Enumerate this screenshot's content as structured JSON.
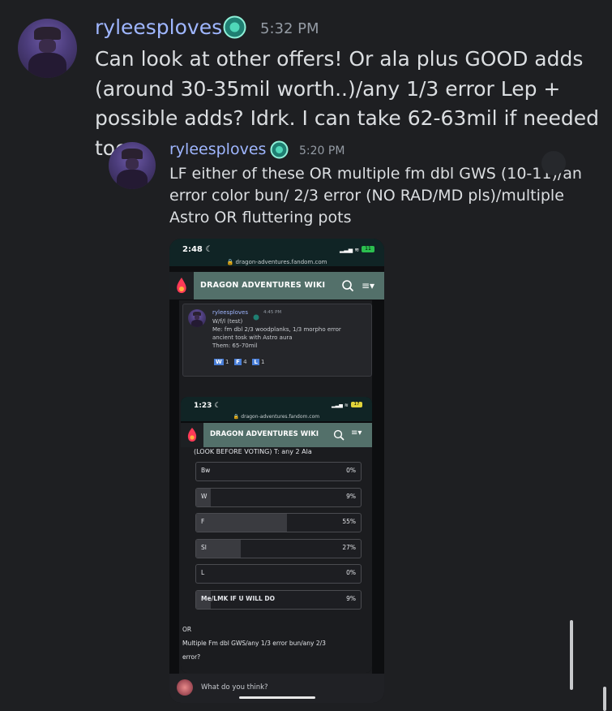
{
  "message1": {
    "username": "ryleesploves",
    "time": "5:32 PM",
    "lines": [
      "Can look at other offers! Or ala plus GOOD adds",
      "(around 30-35mil worth..)/any 1/3 error Lep +",
      "possible adds? Idrk. I can take 62-63mil if needed too"
    ]
  },
  "reply": {
    "username": "ryleesploves",
    "time": "5:20 PM",
    "lines": [
      "LF either of these OR multiple fm dbl GWS (10-11)/an",
      "error color bun/ 2/3 error (NO RAD/MD pls)/multiple",
      "Astro OR fluttering pots"
    ]
  },
  "phone": {
    "time": "2:48",
    "battery": "11",
    "url": "dragon-adventures.fandom.com",
    "wiki_title": "DRAGON ADVENTURES WIKI",
    "inner_post": {
      "username": "ryleesploves",
      "time": "4:45 PM",
      "lines": [
        "W/f/l (test)",
        "Me: fm dbl 2/3 woodplanks, 1/3 morpho error",
        "ancient tosk with Astro aura",
        "Them: 65-70mil"
      ],
      "votes": [
        {
          "key": "W",
          "count": "1"
        },
        {
          "key": "F",
          "count": "4"
        },
        {
          "key": "L",
          "count": "1"
        }
      ]
    },
    "screenshot2": {
      "time": "1:23",
      "battery": "17",
      "url": "dragon-adventures.fandom.com",
      "wiki_title": "DRAGON ADVENTURES WIKI",
      "poll_header": "(LOOK BEFORE VOTING) T: any 2 Ala",
      "poll": [
        {
          "label": "Bw",
          "pct": "0%",
          "value": 0
        },
        {
          "label": "W",
          "pct": "9%",
          "value": 9
        },
        {
          "label": "F",
          "pct": "55%",
          "value": 55
        },
        {
          "label": "Sl",
          "pct": "27%",
          "value": 27
        },
        {
          "label": "L",
          "pct": "0%",
          "value": 0
        },
        {
          "label": "Me/LMK IF U WILL DO",
          "pct": "9%",
          "value": 9
        }
      ],
      "footer_lines": [
        "OR",
        "Multiple Fm dbl GWS/any 1/3 error bun/any 2/3",
        "error?"
      ]
    },
    "comment_placeholder": "What do you think?"
  }
}
